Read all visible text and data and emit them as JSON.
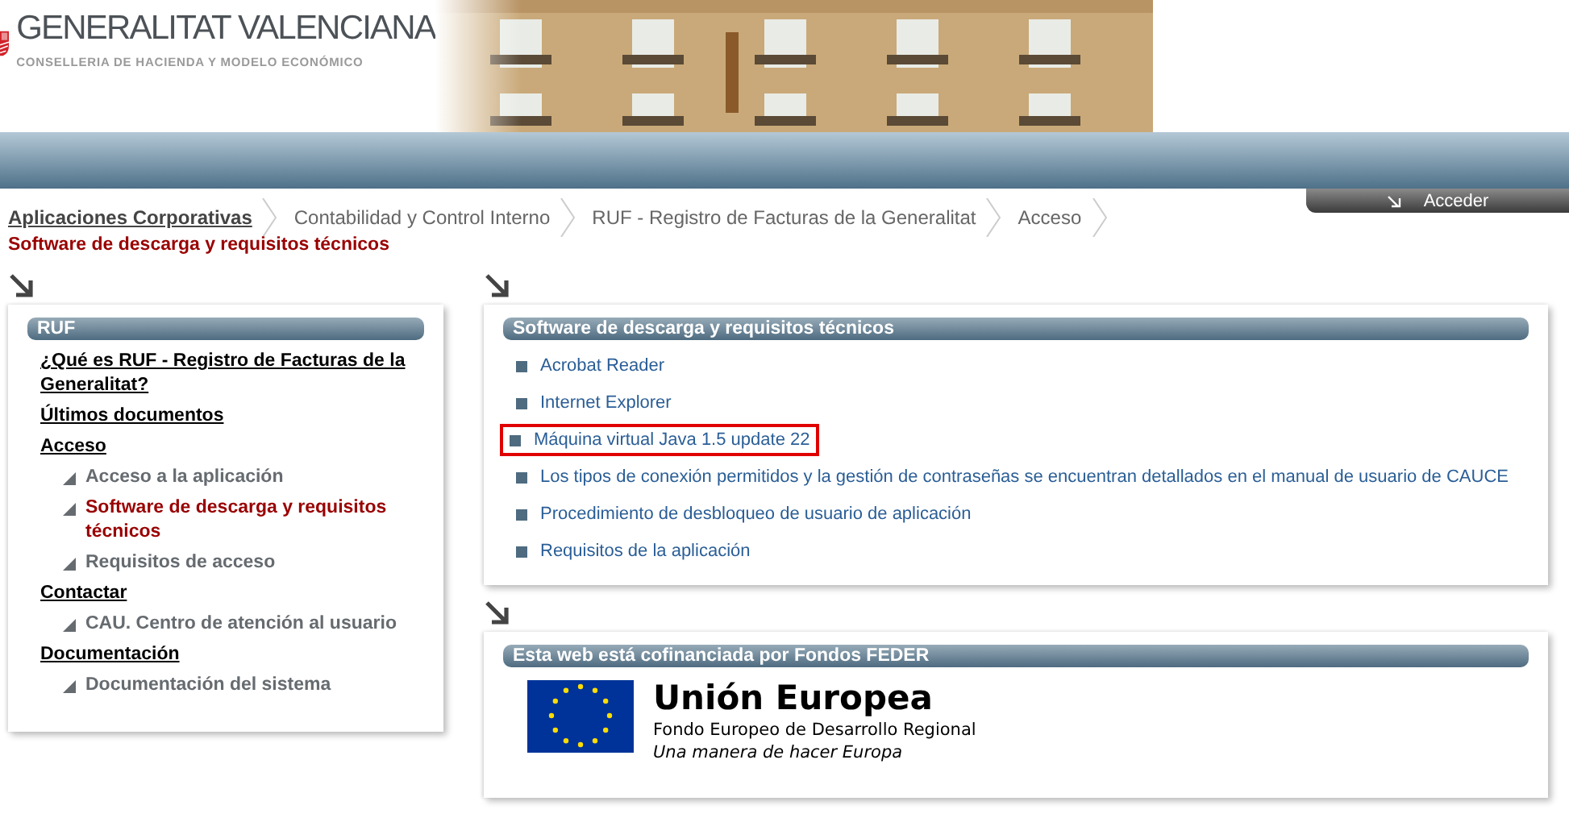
{
  "header": {
    "title": "GENERALITAT VALENCIANA",
    "subtitle": "CONSELLERIA DE HACIENDA Y MODELO ECONÓMICO"
  },
  "breadcrumb": [
    {
      "label": "Aplicaciones Corporativas",
      "kind": "home"
    },
    {
      "label": "Contabilidad y Control Interno",
      "kind": "link"
    },
    {
      "label": "RUF - Registro de Facturas de la Generalitat",
      "kind": "link"
    },
    {
      "label": "Acceso",
      "kind": "link"
    }
  ],
  "login_tab": {
    "label": "Acceder"
  },
  "page_title": "Software de descarga y requisitos técnicos",
  "sidebar": {
    "title": "RUF",
    "items": [
      {
        "label": "¿Qué es RUF - Registro de Facturas de la Generalitat?",
        "selected": false
      },
      {
        "label": "Últimos documentos",
        "selected": false
      },
      {
        "label": "Acceso",
        "selected": false,
        "children": [
          {
            "label": "Acceso a la aplicación",
            "selected": false
          },
          {
            "label": "Software de descarga y requisitos técnicos",
            "selected": true
          },
          {
            "label": "Requisitos de acceso",
            "selected": false
          }
        ]
      },
      {
        "label": "Contactar",
        "selected": false,
        "children": [
          {
            "label": "CAU. Centro de atención al usuario",
            "selected": false
          }
        ]
      },
      {
        "label": "Documentación",
        "selected": false,
        "children": [
          {
            "label": "Documentación del sistema",
            "selected": false
          }
        ]
      }
    ]
  },
  "software": {
    "title": "Software de descarga y requisitos técnicos",
    "items": [
      {
        "label": "Acrobat Reader",
        "highlighted": false
      },
      {
        "label": "Internet Explorer",
        "highlighted": false
      },
      {
        "label": "Máquina virtual Java 1.5 update 22",
        "highlighted": true
      },
      {
        "label": "Los tipos de conexión permitidos y la gestión de contraseñas se encuentran detallados en el manual de usuario de CAUCE",
        "highlighted": false
      },
      {
        "label": "Procedimiento de desbloqueo de usuario de aplicación",
        "highlighted": false
      },
      {
        "label": "Requisitos de la aplicación",
        "highlighted": false
      }
    ]
  },
  "feder": {
    "title": "Esta web está cofinanciada por Fondos FEDER",
    "eu_name": "Unión Europea",
    "eu_fund": "Fondo Europeo de Desarrollo Regional",
    "eu_motto": "Una manera de hacer Europa"
  }
}
